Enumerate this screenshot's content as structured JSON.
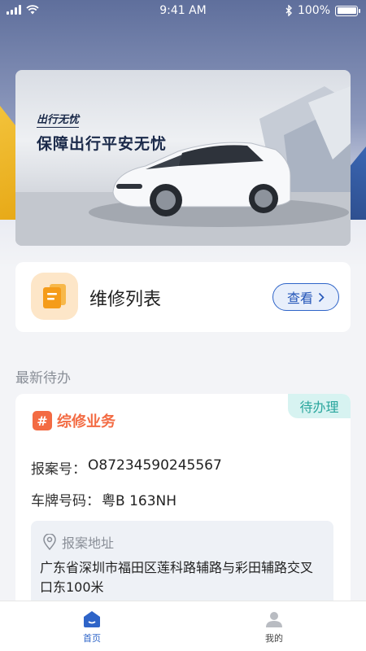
{
  "status_bar": {
    "time": "9:41 AM",
    "battery": "100%"
  },
  "banner": {
    "tag": "出行无忧",
    "title": "保障出行平安无忧"
  },
  "repair_card": {
    "title": "维修列表",
    "button_label": "查看"
  },
  "section": {
    "title": "最新待办"
  },
  "task": {
    "status": "待办理",
    "type": "综修业务",
    "case_label": "报案号：",
    "case_number": "O87234590245567",
    "plate_label": "车牌号码：",
    "plate_number": "粤B 163NH",
    "address_label": "报案地址",
    "address": "广东省深圳市福田区莲科路辅路与彩田辅路交叉口东100米"
  },
  "tabs": [
    {
      "label": "首页",
      "icon": "home-icon",
      "active": true
    },
    {
      "label": "我的",
      "icon": "user-icon",
      "active": false
    }
  ],
  "colors": {
    "primary": "#2e64c8",
    "accent": "#f36b43",
    "badge": "#2aa69d"
  }
}
